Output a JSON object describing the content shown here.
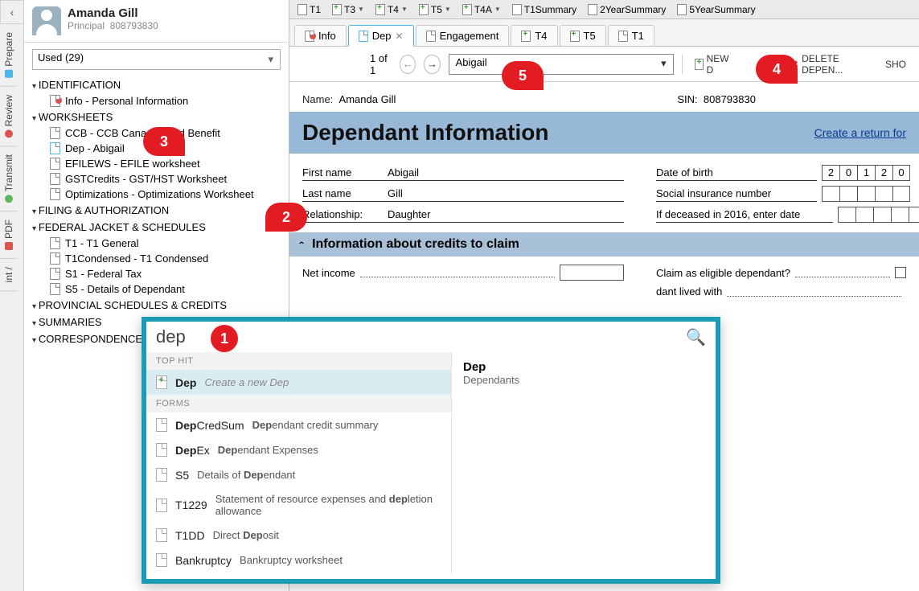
{
  "rail": {
    "prepare": "Prepare",
    "review": "Review",
    "transmit": "Transmit",
    "pdf": "PDF",
    "print": "int /"
  },
  "profile": {
    "name": "Amanda Gill",
    "role": "Principal",
    "id": "808793830"
  },
  "filter": {
    "label": "Used (29)"
  },
  "tree": {
    "s1": "IDENTIFICATION",
    "s1a": "Info - Personal Information",
    "s2": "WORKSHEETS",
    "s2a": "CCB - CCB Canada Child Benefit",
    "s2b": "Dep - Abigail",
    "s2c": "EFILEWS - EFILE worksheet",
    "s2d": "GSTCredits - GST/HST Worksheet",
    "s2e": "Optimizations - Optimizations Worksheet",
    "s3": "FILING & AUTHORIZATION",
    "s4": "FEDERAL JACKET & SCHEDULES",
    "s4a": "T1 - T1 General",
    "s4b": "T1Condensed - T1 Condensed",
    "s4c": "S1 - Federal Tax",
    "s4d": "S5 - Details of Dependant",
    "s5": "PROVINCIAL SCHEDULES & CREDITS",
    "s6": "SUMMARIES",
    "s7": "CORRESPONDENCE"
  },
  "docToolbar": {
    "t1": "T1",
    "t3": "T3",
    "t4": "T4",
    "t5": "T5",
    "t4a": "T4A",
    "t1s": "T1Summary",
    "y2": "2YearSummary",
    "y5": "5YearSummary"
  },
  "innerTabs": {
    "info": "Info",
    "dep": "Dep",
    "eng": "Engagement",
    "t4": "T4",
    "t5": "T5",
    "t1": "T1"
  },
  "actionBar": {
    "counter": "1 of 1",
    "selected": "Abigail",
    "newBtn": "NEW D",
    "deleteBtn": "DELETE DEPEN...",
    "showBtn": "SHO"
  },
  "form": {
    "nameLabel": "Name:",
    "nameVal": "Amanda Gill",
    "sinLabel": "SIN:",
    "sinVal": "808793830",
    "title": "Dependant Information",
    "createLink": "Create a return for",
    "firstNameL": "First name",
    "firstNameV": "Abigail",
    "lastNameL": "Last name",
    "lastNameV": "Gill",
    "relL": "Relationship:",
    "relV": "Daughter",
    "dobL": "Date of birth",
    "dobCells": [
      "2",
      "0",
      "1",
      "2",
      "0"
    ],
    "sinNumL": "Social insurance number",
    "deceasedL": "If deceased in 2016, enter date",
    "sectionTitle": "Information about credits to claim",
    "netIncomeL": "Net income",
    "eligibleL": "Claim as eligible dependant?",
    "livedWithL": "dant lived with"
  },
  "search": {
    "query": "dep",
    "topHitHdr": "TOP HIT",
    "topHitCode": "Dep",
    "topHitDesc": "Create a new Dep",
    "formsHdr": "FORMS",
    "rows": [
      {
        "code": "DepCredSum",
        "codeBold": "Dep",
        "codeRest": "CredSum",
        "desc1": "Dep",
        "desc2": "endant credit summary"
      },
      {
        "code": "DepEx",
        "codeBold": "Dep",
        "codeRest": "Ex",
        "desc1": "Dep",
        "desc2": "endant Expenses"
      },
      {
        "code": "S5",
        "codeBold": "",
        "codeRest": "S5",
        "desc1": "",
        "desc2": "Details of ",
        "descB": "Dep",
        "desc3": "endant"
      },
      {
        "code": "T1229",
        "codeBold": "",
        "codeRest": "T1229",
        "desc1": "",
        "desc2": "Statement of resource expenses and ",
        "descB": "dep",
        "desc3": "letion allowance"
      },
      {
        "code": "T1DD",
        "codeBold": "",
        "codeRest": "T1DD",
        "desc1": "",
        "desc2": "Direct ",
        "descB": "Dep",
        "desc3": "osit"
      },
      {
        "code": "Bankruptcy",
        "codeBold": "",
        "codeRest": "Bankruptcy",
        "desc1": "",
        "desc2": "Bankruptcy worksheet"
      }
    ],
    "resultTitle": "Dep",
    "resultSub": "Dependants"
  },
  "callouts": {
    "c1": "1",
    "c2": "2",
    "c3": "3",
    "c4": "4",
    "c5": "5"
  }
}
